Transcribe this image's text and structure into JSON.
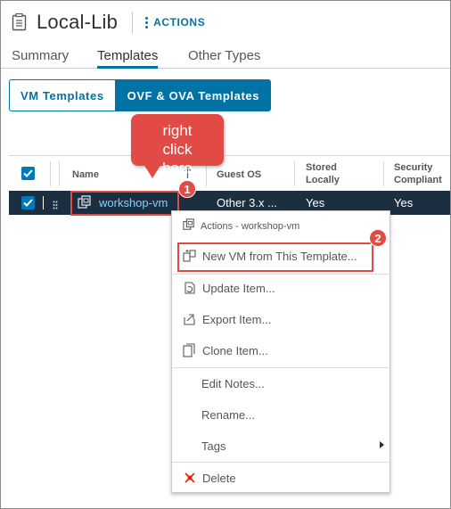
{
  "header": {
    "title": "Local-Lib",
    "actions_label": "ACTIONS",
    "icon": "library-icon"
  },
  "tabs": [
    {
      "label": "Summary",
      "active": false
    },
    {
      "label": "Templates",
      "active": true
    },
    {
      "label": "Other Types",
      "active": false
    }
  ],
  "segmented": {
    "vm_templates": "VM Templates",
    "ovf_templates": "OVF & OVA Templates",
    "selected": "OVF & OVA Templates"
  },
  "grid": {
    "columns": {
      "name": "Name",
      "guest_os": "Guest OS",
      "stored_locally": "Stored Locally",
      "security_compliant": "Security Compliant"
    },
    "rows": [
      {
        "name": "workshop-vm",
        "guest_os": "Other 3.x ...",
        "stored_locally": "Yes",
        "security_compliant": "Yes",
        "selected": true
      }
    ]
  },
  "callout": {
    "text": "right click here",
    "step1": "1",
    "step2": "2"
  },
  "context_menu": {
    "header": "Actions - workshop-vm",
    "items": [
      {
        "label": "New VM from This Template...",
        "icon": "new-vm-icon"
      },
      {
        "label": "Update Item...",
        "icon": "update-icon"
      },
      {
        "label": "Export Item...",
        "icon": "export-icon"
      },
      {
        "label": "Clone Item...",
        "icon": "clone-icon"
      },
      {
        "label": "Edit Notes..."
      },
      {
        "label": "Rename..."
      },
      {
        "label": "Tags",
        "submenu": true
      },
      {
        "label": "Delete",
        "icon": "delete-icon"
      }
    ]
  },
  "colors": {
    "accent": "#0072a3",
    "selected_row": "#1c2f40",
    "annotation_red": "#e24a45",
    "delete_red": "#e12200"
  }
}
